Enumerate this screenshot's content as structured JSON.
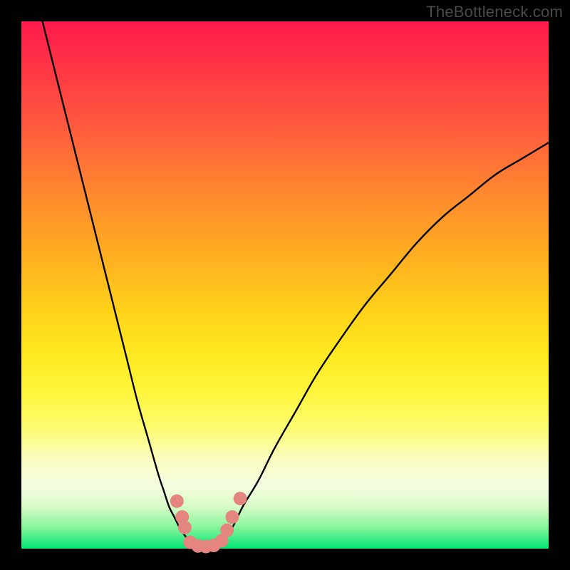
{
  "watermark": "TheBottleneck.com",
  "colors": {
    "curve": "#000000",
    "marker_fill": "#e5857f",
    "marker_stroke": "#c96a64"
  },
  "chart_data": {
    "type": "line",
    "title": "",
    "xlabel": "",
    "ylabel": "",
    "xlim": [
      0,
      100
    ],
    "ylim": [
      0,
      100
    ],
    "series": [
      {
        "name": "left-curve",
        "x": [
          4,
          6,
          8,
          10,
          12,
          14,
          16,
          18,
          20,
          22,
          24,
          26,
          27,
          28,
          29,
          30,
          31,
          32,
          33
        ],
        "y": [
          100,
          92,
          84,
          76,
          68,
          60,
          52,
          44,
          36,
          28,
          21,
          14,
          11,
          8,
          6,
          4,
          2.5,
          1.2,
          0
        ]
      },
      {
        "name": "right-curve",
        "x": [
          37,
          38,
          40,
          42,
          45,
          48,
          52,
          56,
          60,
          65,
          70,
          75,
          80,
          85,
          90,
          95,
          100
        ],
        "y": [
          0,
          1.5,
          4,
          8,
          13,
          19,
          26,
          33,
          39,
          46,
          52,
          58,
          63,
          67,
          71,
          74,
          77
        ]
      }
    ],
    "markers": {
      "name": "bottleneck-region",
      "points": [
        {
          "x": 29.5,
          "y": 9
        },
        {
          "x": 30.5,
          "y": 6
        },
        {
          "x": 31.0,
          "y": 4
        },
        {
          "x": 32.0,
          "y": 1.2
        },
        {
          "x": 33.5,
          "y": 0.5
        },
        {
          "x": 35.0,
          "y": 0.4
        },
        {
          "x": 36.5,
          "y": 0.6
        },
        {
          "x": 38.0,
          "y": 1.5
        },
        {
          "x": 39.0,
          "y": 3.5
        },
        {
          "x": 40.0,
          "y": 6
        },
        {
          "x": 41.5,
          "y": 9.5
        }
      ]
    }
  }
}
